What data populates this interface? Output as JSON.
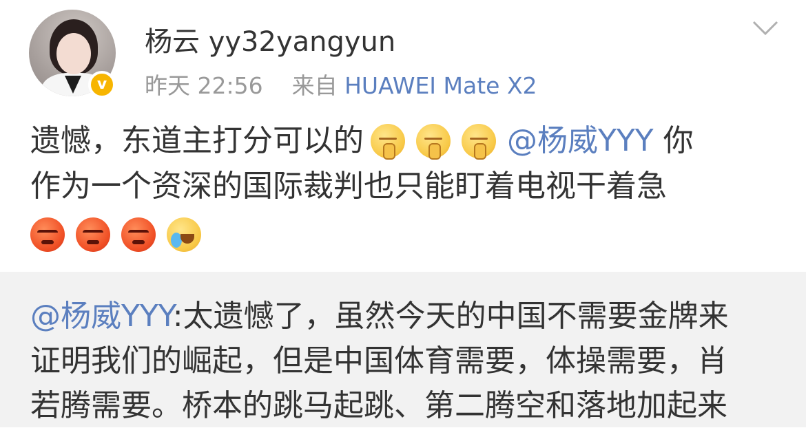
{
  "post": {
    "username": "杨云 yy32yangyun",
    "time": "昨天 22:56",
    "source_prefix": "来自",
    "source": "HUAWEI Mate X2",
    "content": {
      "line1_text": "遗憾，东道主打分可以的",
      "mention": "@杨威YYY",
      "line1_tail": "你",
      "line2": "作为一个资深的国际裁判也只能盯着电视干着急",
      "emojis_line1": [
        "shush-emoji",
        "shush-emoji",
        "shush-emoji"
      ],
      "emojis_line3": [
        "angry-emoji",
        "angry-emoji",
        "angry-emoji",
        "laugh-cry-emoji"
      ]
    },
    "verified_badge": "v",
    "colors": {
      "link": "#5b7fbf",
      "meta": "#999999",
      "badge": "#f7b500"
    }
  },
  "repost": {
    "mention": "@杨威YYY",
    "line1_text": ":太遗憾了，虽然今天的中国不需要金牌来",
    "line2": "证明我们的崛起，但是中国体育需要，体操需要，肖",
    "line3": "若腾需要。桥本的跳马起跳、第二腾空和落地加起来"
  }
}
